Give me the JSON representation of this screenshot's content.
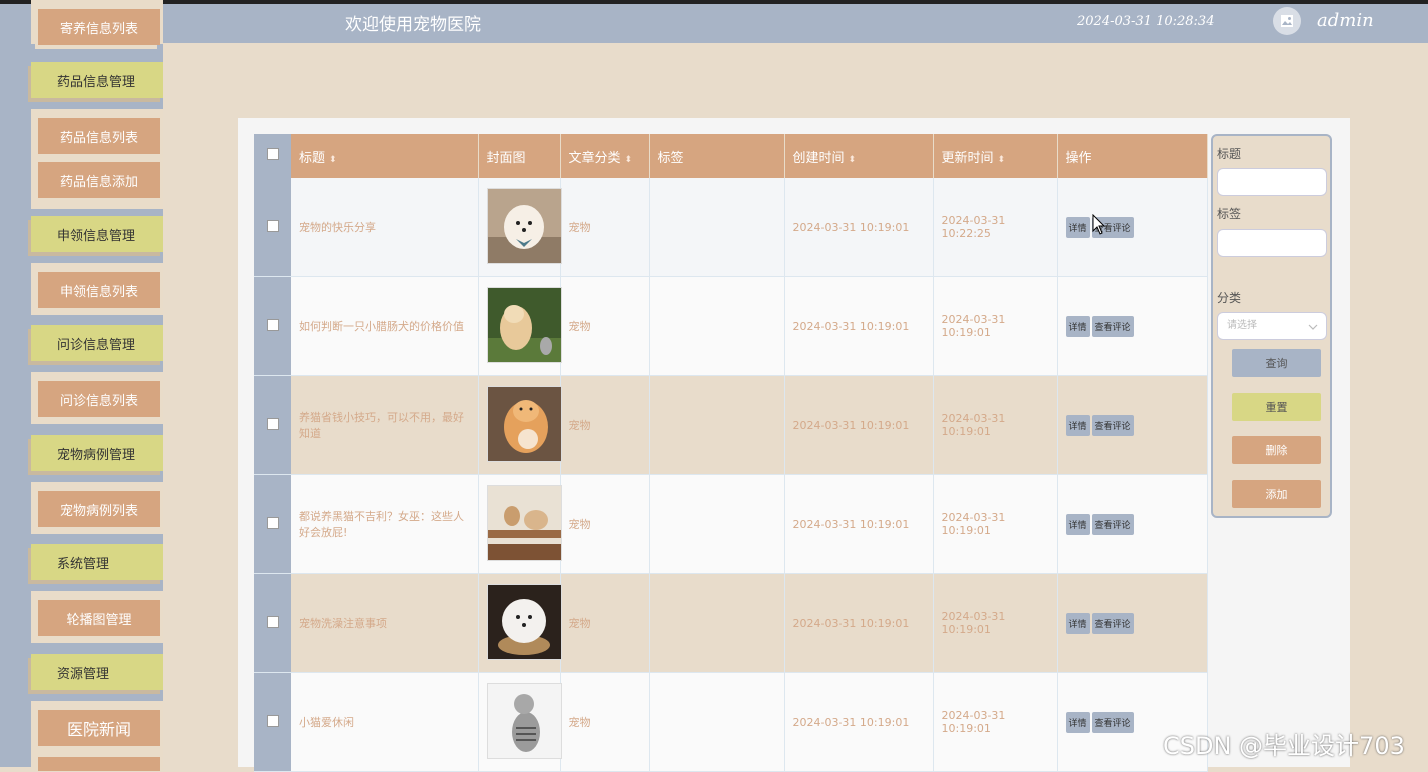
{
  "header": {
    "title": "欢迎使用宠物医院",
    "time": "2024-03-31 10:28:34",
    "username": "admin"
  },
  "sidebar": {
    "items": [
      {
        "label": "寄养信息列表",
        "type": "sub"
      },
      {
        "label": "药品信息管理",
        "type": "head"
      },
      {
        "label": "药品信息列表",
        "type": "sub"
      },
      {
        "label": "药品信息添加",
        "type": "sub"
      },
      {
        "label": "申领信息管理",
        "type": "head"
      },
      {
        "label": "申领信息列表",
        "type": "sub"
      },
      {
        "label": "问诊信息管理",
        "type": "head"
      },
      {
        "label": "问诊信息列表",
        "type": "sub"
      },
      {
        "label": "宠物病例管理",
        "type": "head"
      },
      {
        "label": "宠物病例列表",
        "type": "sub"
      },
      {
        "label": "系统管理",
        "type": "head"
      },
      {
        "label": "轮播图管理",
        "type": "sub"
      },
      {
        "label": "资源管理",
        "type": "head"
      },
      {
        "label": "医院新闻",
        "type": "sub"
      }
    ]
  },
  "table": {
    "headers": [
      "标题",
      "封面图",
      "文章分类",
      "标签",
      "创建时间",
      "更新时间",
      "操作"
    ],
    "action_detail": "详情",
    "action_comments": "查看评论",
    "rows": [
      {
        "title": "宠物的快乐分享",
        "category": "宠物",
        "tag": "",
        "created": "2024-03-31 10:19:01",
        "updated": "2024-03-31 10:22:25",
        "image": "white-puppy"
      },
      {
        "title": "如何判断一只小腊肠犬的价格价值",
        "category": "宠物",
        "tag": "",
        "created": "2024-03-31 10:19:01",
        "updated": "2024-03-31 10:19:01",
        "image": "golden-puppy"
      },
      {
        "title": "养猫省钱小技巧，可以不用，最好知道",
        "category": "宠物",
        "tag": "",
        "created": "2024-03-31 10:19:01",
        "updated": "2024-03-31 10:19:01",
        "image": "orange-cat"
      },
      {
        "title": "都说养黑猫不吉利？女巫：这些人好会放屁!",
        "category": "宠物",
        "tag": "",
        "created": "2024-03-31 10:19:01",
        "updated": "2024-03-31 10:19:01",
        "image": "cat-stairs"
      },
      {
        "title": "宠物洗澡注意事项",
        "category": "宠物",
        "tag": "",
        "created": "2024-03-31 10:19:01",
        "updated": "2024-03-31 10:19:01",
        "image": "fluffy-dog"
      },
      {
        "title": "小猫爱休闲",
        "category": "宠物",
        "tag": "",
        "created": "2024-03-31 10:19:01",
        "updated": "2024-03-31 10:19:01",
        "image": "tabby-cat"
      }
    ]
  },
  "search": {
    "title_label": "标题",
    "tag_label": "标签",
    "category_label": "分类",
    "category_placeholder": "请选择",
    "query_button": "查询",
    "reset_button": "重置",
    "delete_button": "删除",
    "add_button": "添加"
  },
  "watermark": "CSDN @毕业设计703",
  "colors": {
    "accent": "#d6a580",
    "nav_blue": "#a8b4c6",
    "nav_yellow": "#d8d785",
    "background": "#e8dccb"
  }
}
